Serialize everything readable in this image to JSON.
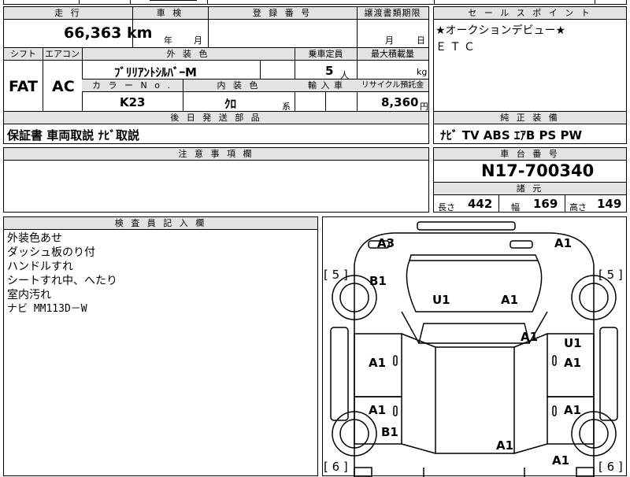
{
  "top_partial": {
    "left": "",
    "center": "",
    "right": ""
  },
  "mileage": {
    "header": "走 行",
    "value": "66,363",
    "unit": "km"
  },
  "shaken": {
    "header": "車 検",
    "year_label": "年",
    "month_label": "月"
  },
  "registration": {
    "header": "登 録 番 号",
    "value": ""
  },
  "transfer_deadline": {
    "header": "譲渡書類期限",
    "month_label": "月",
    "day_label": "日"
  },
  "shift": {
    "header": "シフト",
    "value": "FAT"
  },
  "aircon": {
    "header": "エアコン",
    "value": "AC"
  },
  "exterior_color": {
    "header": "外 装 色",
    "value": "ﾌﾞﾘﾘｱﾝﾄｼﾙﾊﾞｰM"
  },
  "color_no": {
    "header": "カ ラ ー N o .",
    "value": "K23"
  },
  "interior_color": {
    "header": "内 装 色",
    "value": "ｸﾛ",
    "suffix": "系"
  },
  "capacity": {
    "header": "乗車定員",
    "value": "5",
    "unit": "人"
  },
  "import": {
    "header": "輸 入 車",
    "value": ""
  },
  "max_load": {
    "header": "最大積載量",
    "value": "",
    "unit": "kg"
  },
  "recycle": {
    "header": "リサイクル預託金",
    "value": "8,360",
    "unit": "円"
  },
  "sales_point": {
    "header": "セ ー ル ス ポ イ ン ト",
    "lines": [
      "★オークションデビュー★",
      "ＥＴＣ"
    ]
  },
  "later_parts": {
    "header": "後 日 発 送 部 品",
    "value": "保証書 車両取説 ﾅﾋﾞ取説"
  },
  "genuine_equipment": {
    "header": "純 正 装 備",
    "value": "ﾅﾋﾞ TV ABS ｴｱB PS PW"
  },
  "caution": {
    "header": "注 意 事 項 欄",
    "value": ""
  },
  "chassis": {
    "header": "車 台 番 号",
    "value": "N17-700340"
  },
  "specs": {
    "header": "諸 元",
    "length_label": "長さ",
    "length": "442",
    "width_label": "幅",
    "width": "169",
    "height_label": "高さ",
    "height": "149"
  },
  "inspector": {
    "header": "検 査 員 記 入 欄",
    "notes": [
      "外装色あせ",
      "ダッシュ板のり付",
      "ハンドルすれ",
      "シートすれ中、へたり",
      "室内汚れ",
      "ナビ MM113D－W"
    ]
  },
  "damage_map": {
    "marks": [
      {
        "id": "front-left-corner",
        "text": "A3"
      },
      {
        "id": "front-right-corner",
        "text": "A1"
      },
      {
        "id": "left-fender",
        "text": "B1"
      },
      {
        "id": "hood-left",
        "text": "U1"
      },
      {
        "id": "hood-right",
        "text": "A1"
      },
      {
        "id": "windshield-right",
        "text": "A1"
      },
      {
        "id": "right-front-door-1",
        "text": "U1"
      },
      {
        "id": "right-front-door-2",
        "text": "A1"
      },
      {
        "id": "left-front-door",
        "text": "A1"
      },
      {
        "id": "left-rear-door",
        "text": "A1"
      },
      {
        "id": "right-rear-door",
        "text": "A1"
      },
      {
        "id": "left-quarter",
        "text": "B1"
      },
      {
        "id": "roof-rear",
        "text": "A1"
      },
      {
        "id": "right-rear-corner",
        "text": "A1"
      }
    ],
    "tire_labels": [
      {
        "id": "tire-front-left",
        "text": "[ 5 ]"
      },
      {
        "id": "tire-front-right",
        "text": "[ 5 ]"
      },
      {
        "id": "tire-rear-left",
        "text": "[ 6 ]"
      },
      {
        "id": "tire-rear-right",
        "text": "[ 6 ]"
      }
    ]
  }
}
